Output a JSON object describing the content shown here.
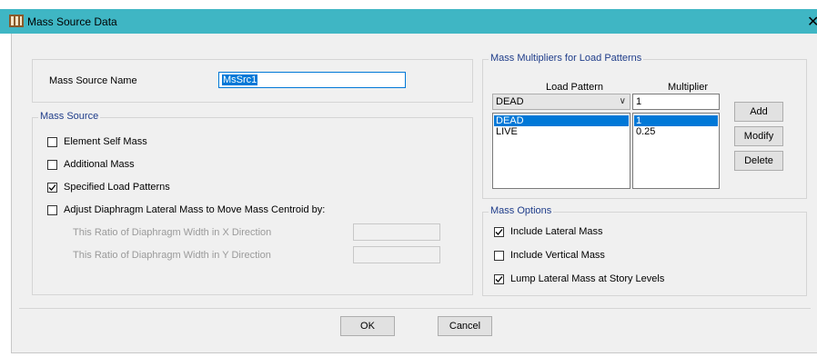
{
  "window": {
    "title": "Mass Source Data",
    "close_glyph": "✕"
  },
  "mass_source_name": {
    "label": "Mass Source Name",
    "value": "MsSrc1"
  },
  "mass_source": {
    "group_title": "Mass Source",
    "options": [
      {
        "label": "Element Self Mass",
        "checked": false
      },
      {
        "label": "Additional Mass",
        "checked": false
      },
      {
        "label": "Specified Load Patterns",
        "checked": true
      },
      {
        "label": "Adjust Diaphragm Lateral Mass to Move Mass Centroid by:",
        "checked": false
      }
    ],
    "ratio_x_label": "This Ratio of Diaphragm Width in X Direction",
    "ratio_y_label": "This Ratio of Diaphragm Width in Y Direction",
    "ratio_x_value": "",
    "ratio_y_value": ""
  },
  "multipliers": {
    "group_title": "Mass Multipliers for Load Patterns",
    "col_load_pattern": "Load Pattern",
    "col_multiplier": "Multiplier",
    "selected_pattern": "DEAD",
    "multiplier_input": "1",
    "rows": [
      {
        "pattern": "DEAD",
        "multiplier": "1",
        "selected": true
      },
      {
        "pattern": "LIVE",
        "multiplier": "0.25",
        "selected": false
      }
    ],
    "add_label": "Add",
    "modify_label": "Modify",
    "delete_label": "Delete"
  },
  "mass_options": {
    "group_title": "Mass Options",
    "options": [
      {
        "label": "Include Lateral Mass",
        "checked": true
      },
      {
        "label": "Include Vertical Mass",
        "checked": false
      },
      {
        "label": "Lump Lateral Mass at Story Levels",
        "checked": true
      }
    ]
  },
  "footer": {
    "ok_label": "OK",
    "cancel_label": "Cancel"
  },
  "colors": {
    "titlebar": "#3fb6c4",
    "group_title": "#1f3d8a",
    "selection": "#0078d7"
  }
}
